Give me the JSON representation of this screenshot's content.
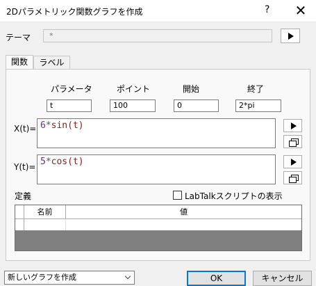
{
  "window": {
    "title": "2Dパラメトリック関数グラフを作成",
    "help": "?",
    "close": "✕"
  },
  "theme": {
    "label": "テーマ",
    "value": "*"
  },
  "tabs": [
    {
      "label": "関数",
      "active": true
    },
    {
      "label": "ラベル",
      "active": false
    }
  ],
  "params": {
    "headers": [
      "パラメータ",
      "ポイント",
      "開始",
      "終了"
    ],
    "values": [
      "t",
      "100",
      "0",
      "2*pi"
    ]
  },
  "x_expr": {
    "label": "X(t)=",
    "num": "6",
    "op": "*",
    "fn": "sin(t)"
  },
  "y_expr": {
    "label": "Y(t)=",
    "num": "5",
    "op": "*",
    "fn": "cos(t)"
  },
  "definitions": {
    "label": "定義",
    "checkbox_label": "LabTalkスクリプトの表示",
    "checked": false,
    "columns": [
      "名前",
      "値"
    ]
  },
  "footer": {
    "select_value": "新しいグラフを作成",
    "ok": "OK",
    "cancel": "キャンセル"
  },
  "icons": {
    "play": "play-icon",
    "copy": "copy-icon",
    "chevron": "chevron-down-icon"
  }
}
